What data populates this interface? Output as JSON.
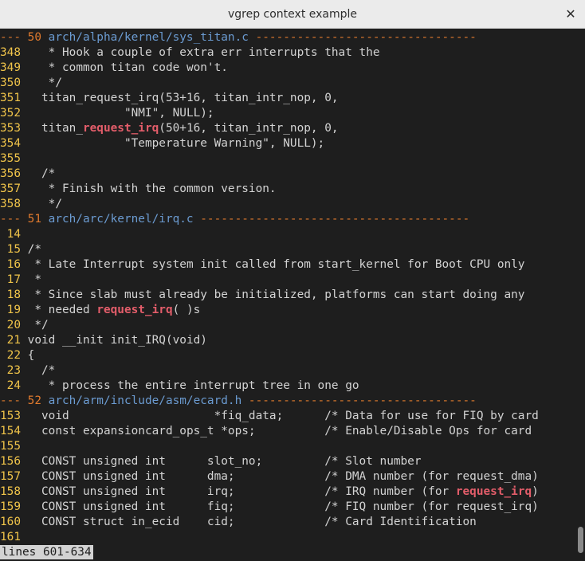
{
  "window": {
    "title": "vgrep context example",
    "close_glyph": "✕"
  },
  "colors": {
    "background": "#1e1e1e",
    "text": "#d3d3d3",
    "separator": "#e07a2e",
    "path": "#6b9bd1",
    "line_number": "#f0c44a",
    "match": "#e35d6a"
  },
  "groups": [
    {
      "sep_prefix": "--- ",
      "file_number": "50",
      "path": "arch/alpha/kernel/sys_titan.c",
      "sep_suffix": " --------------------------------",
      "lines": [
        {
          "num": "348",
          "segments": [
            {
              "text": "   * Hook a couple of extra err interrupts that the"
            }
          ]
        },
        {
          "num": "349",
          "segments": [
            {
              "text": "   * common titan code won't."
            }
          ]
        },
        {
          "num": "350",
          "segments": [
            {
              "text": "   */"
            }
          ]
        },
        {
          "num": "351",
          "segments": [
            {
              "text": "  titan_request_irq(53+16, titan_intr_nop, 0,"
            }
          ]
        },
        {
          "num": "352",
          "segments": [
            {
              "text": "              \"NMI\", NULL);"
            }
          ]
        },
        {
          "num": "353",
          "segments": [
            {
              "text": "  titan_"
            },
            {
              "text": "request_irq",
              "hl": true
            },
            {
              "text": "(50+16, titan_intr_nop, 0,"
            }
          ]
        },
        {
          "num": "354",
          "segments": [
            {
              "text": "              \"Temperature Warning\", NULL);"
            }
          ]
        },
        {
          "num": "355",
          "segments": [
            {
              "text": ""
            }
          ]
        },
        {
          "num": "356",
          "segments": [
            {
              "text": "  /*"
            }
          ]
        },
        {
          "num": "357",
          "segments": [
            {
              "text": "   * Finish with the common version."
            }
          ]
        },
        {
          "num": "358",
          "segments": [
            {
              "text": "   */"
            }
          ]
        }
      ]
    },
    {
      "sep_prefix": "--- ",
      "file_number": "51",
      "path": "arch/arc/kernel/irq.c",
      "sep_suffix": " ---------------------------------------",
      "lines": [
        {
          "num": " 14",
          "segments": [
            {
              "text": ""
            }
          ]
        },
        {
          "num": " 15",
          "segments": [
            {
              "text": "/*"
            }
          ]
        },
        {
          "num": " 16",
          "segments": [
            {
              "text": " * Late Interrupt system init called from start_kernel for Boot CPU only"
            }
          ]
        },
        {
          "num": " 17",
          "segments": [
            {
              "text": " *"
            }
          ]
        },
        {
          "num": " 18",
          "segments": [
            {
              "text": " * Since slab must already be initialized, platforms can start doing any"
            }
          ]
        },
        {
          "num": " 19",
          "segments": [
            {
              "text": " * needed "
            },
            {
              "text": "request_irq",
              "hl": true
            },
            {
              "text": "( )s"
            }
          ]
        },
        {
          "num": " 20",
          "segments": [
            {
              "text": " */"
            }
          ]
        },
        {
          "num": " 21",
          "segments": [
            {
              "text": "void __init init_IRQ(void)"
            }
          ]
        },
        {
          "num": " 22",
          "segments": [
            {
              "text": "{"
            }
          ]
        },
        {
          "num": " 23",
          "segments": [
            {
              "text": "  /*"
            }
          ]
        },
        {
          "num": " 24",
          "segments": [
            {
              "text": "   * process the entire interrupt tree in one go"
            }
          ]
        }
      ]
    },
    {
      "sep_prefix": "--- ",
      "file_number": "52",
      "path": "arch/arm/include/asm/ecard.h",
      "sep_suffix": " ---------------------------------",
      "lines": [
        {
          "num": "153",
          "segments": [
            {
              "text": "  void                     *fiq_data;      /* Data for use for FIQ by card"
            }
          ]
        },
        {
          "num": "154",
          "segments": [
            {
              "text": "  const expansioncard_ops_t *ops;          /* Enable/Disable Ops for card"
            }
          ]
        },
        {
          "num": "155",
          "segments": [
            {
              "text": ""
            }
          ]
        },
        {
          "num": "156",
          "segments": [
            {
              "text": "  CONST unsigned int      slot_no;         /* Slot number"
            }
          ]
        },
        {
          "num": "157",
          "segments": [
            {
              "text": "  CONST unsigned int      dma;             /* DMA number (for request_dma)"
            }
          ]
        },
        {
          "num": "158",
          "segments": [
            {
              "text": "  CONST unsigned int      irq;             /* IRQ number (for "
            },
            {
              "text": "request_irq",
              "hl": true
            },
            {
              "text": ")"
            }
          ]
        },
        {
          "num": "159",
          "segments": [
            {
              "text": "  CONST unsigned int      fiq;             /* FIQ number (for request_irq)"
            }
          ]
        },
        {
          "num": "160",
          "segments": [
            {
              "text": "  CONST struct in_ecid    cid;             /* Card Identification"
            }
          ]
        },
        {
          "num": "161",
          "segments": [
            {
              "text": ""
            }
          ]
        }
      ]
    }
  ],
  "status": {
    "text": "lines 601-634"
  },
  "scrollbar": {
    "thumb_position": 0.96,
    "thumb_size": 0.05
  }
}
